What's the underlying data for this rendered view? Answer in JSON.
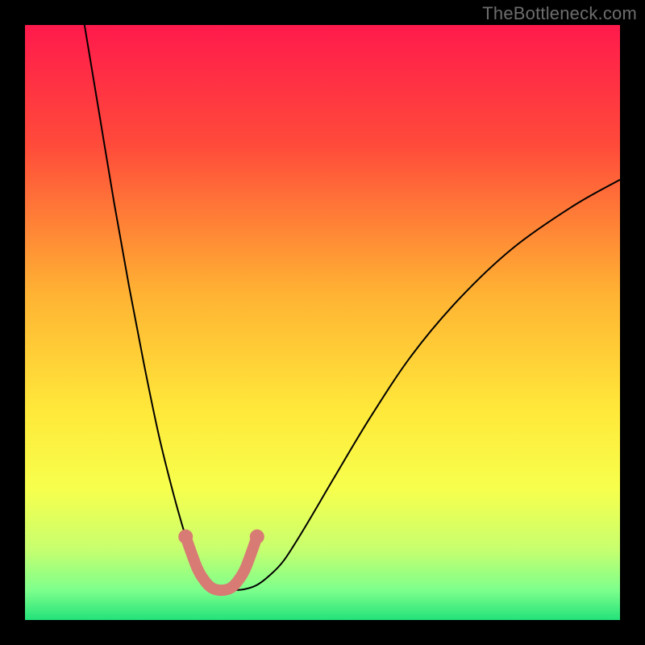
{
  "watermark": "TheBottleneck.com",
  "chart_data": {
    "type": "line",
    "title": "",
    "xlabel": "",
    "ylabel": "",
    "xlim": [
      0,
      100
    ],
    "ylim": [
      0,
      100
    ],
    "background_gradient": {
      "stops": [
        {
          "offset": 0,
          "color": "#ff1a4c"
        },
        {
          "offset": 20,
          "color": "#ff4a3a"
        },
        {
          "offset": 45,
          "color": "#ffb233"
        },
        {
          "offset": 65,
          "color": "#ffe93a"
        },
        {
          "offset": 78,
          "color": "#f7ff4d"
        },
        {
          "offset": 88,
          "color": "#c8ff6e"
        },
        {
          "offset": 95,
          "color": "#7dff8c"
        },
        {
          "offset": 100,
          "color": "#23e27a"
        }
      ]
    },
    "series": [
      {
        "name": "bottleneck-curve",
        "stroke": "#000000",
        "stroke_width": 2,
        "x": [
          10.0,
          12.5,
          15.0,
          17.5,
          20.0,
          22.5,
          25.0,
          27.0,
          28.5,
          29.8,
          31.2,
          33.0,
          35.0,
          37.0,
          39.0,
          41.0,
          43.5,
          47.0,
          52.0,
          58.0,
          65.0,
          73.0,
          82.0,
          92.0,
          100.0
        ],
        "y": [
          100.0,
          85.0,
          70.0,
          56.0,
          43.0,
          31.0,
          21.0,
          14.0,
          9.5,
          6.8,
          5.3,
          5.0,
          5.0,
          5.2,
          5.9,
          7.4,
          10.0,
          15.5,
          24.0,
          34.0,
          44.5,
          54.0,
          62.5,
          69.5,
          74.0
        ]
      },
      {
        "name": "marker-line",
        "stroke": "#d87b74",
        "stroke_width": 14,
        "linecap": "round",
        "x": [
          27.0,
          28.9,
          30.2,
          31.4,
          33.0,
          34.6,
          35.8,
          37.1,
          39.0
        ],
        "y": [
          14.0,
          8.8,
          6.6,
          5.4,
          5.0,
          5.4,
          6.6,
          8.8,
          14.0
        ]
      }
    ],
    "markers": [
      {
        "name": "marker-left",
        "x": 27.0,
        "y": 14.0,
        "r": 9,
        "fill": "#d87b74"
      },
      {
        "name": "marker-right",
        "x": 39.0,
        "y": 14.0,
        "r": 9,
        "fill": "#d87b74"
      }
    ]
  }
}
